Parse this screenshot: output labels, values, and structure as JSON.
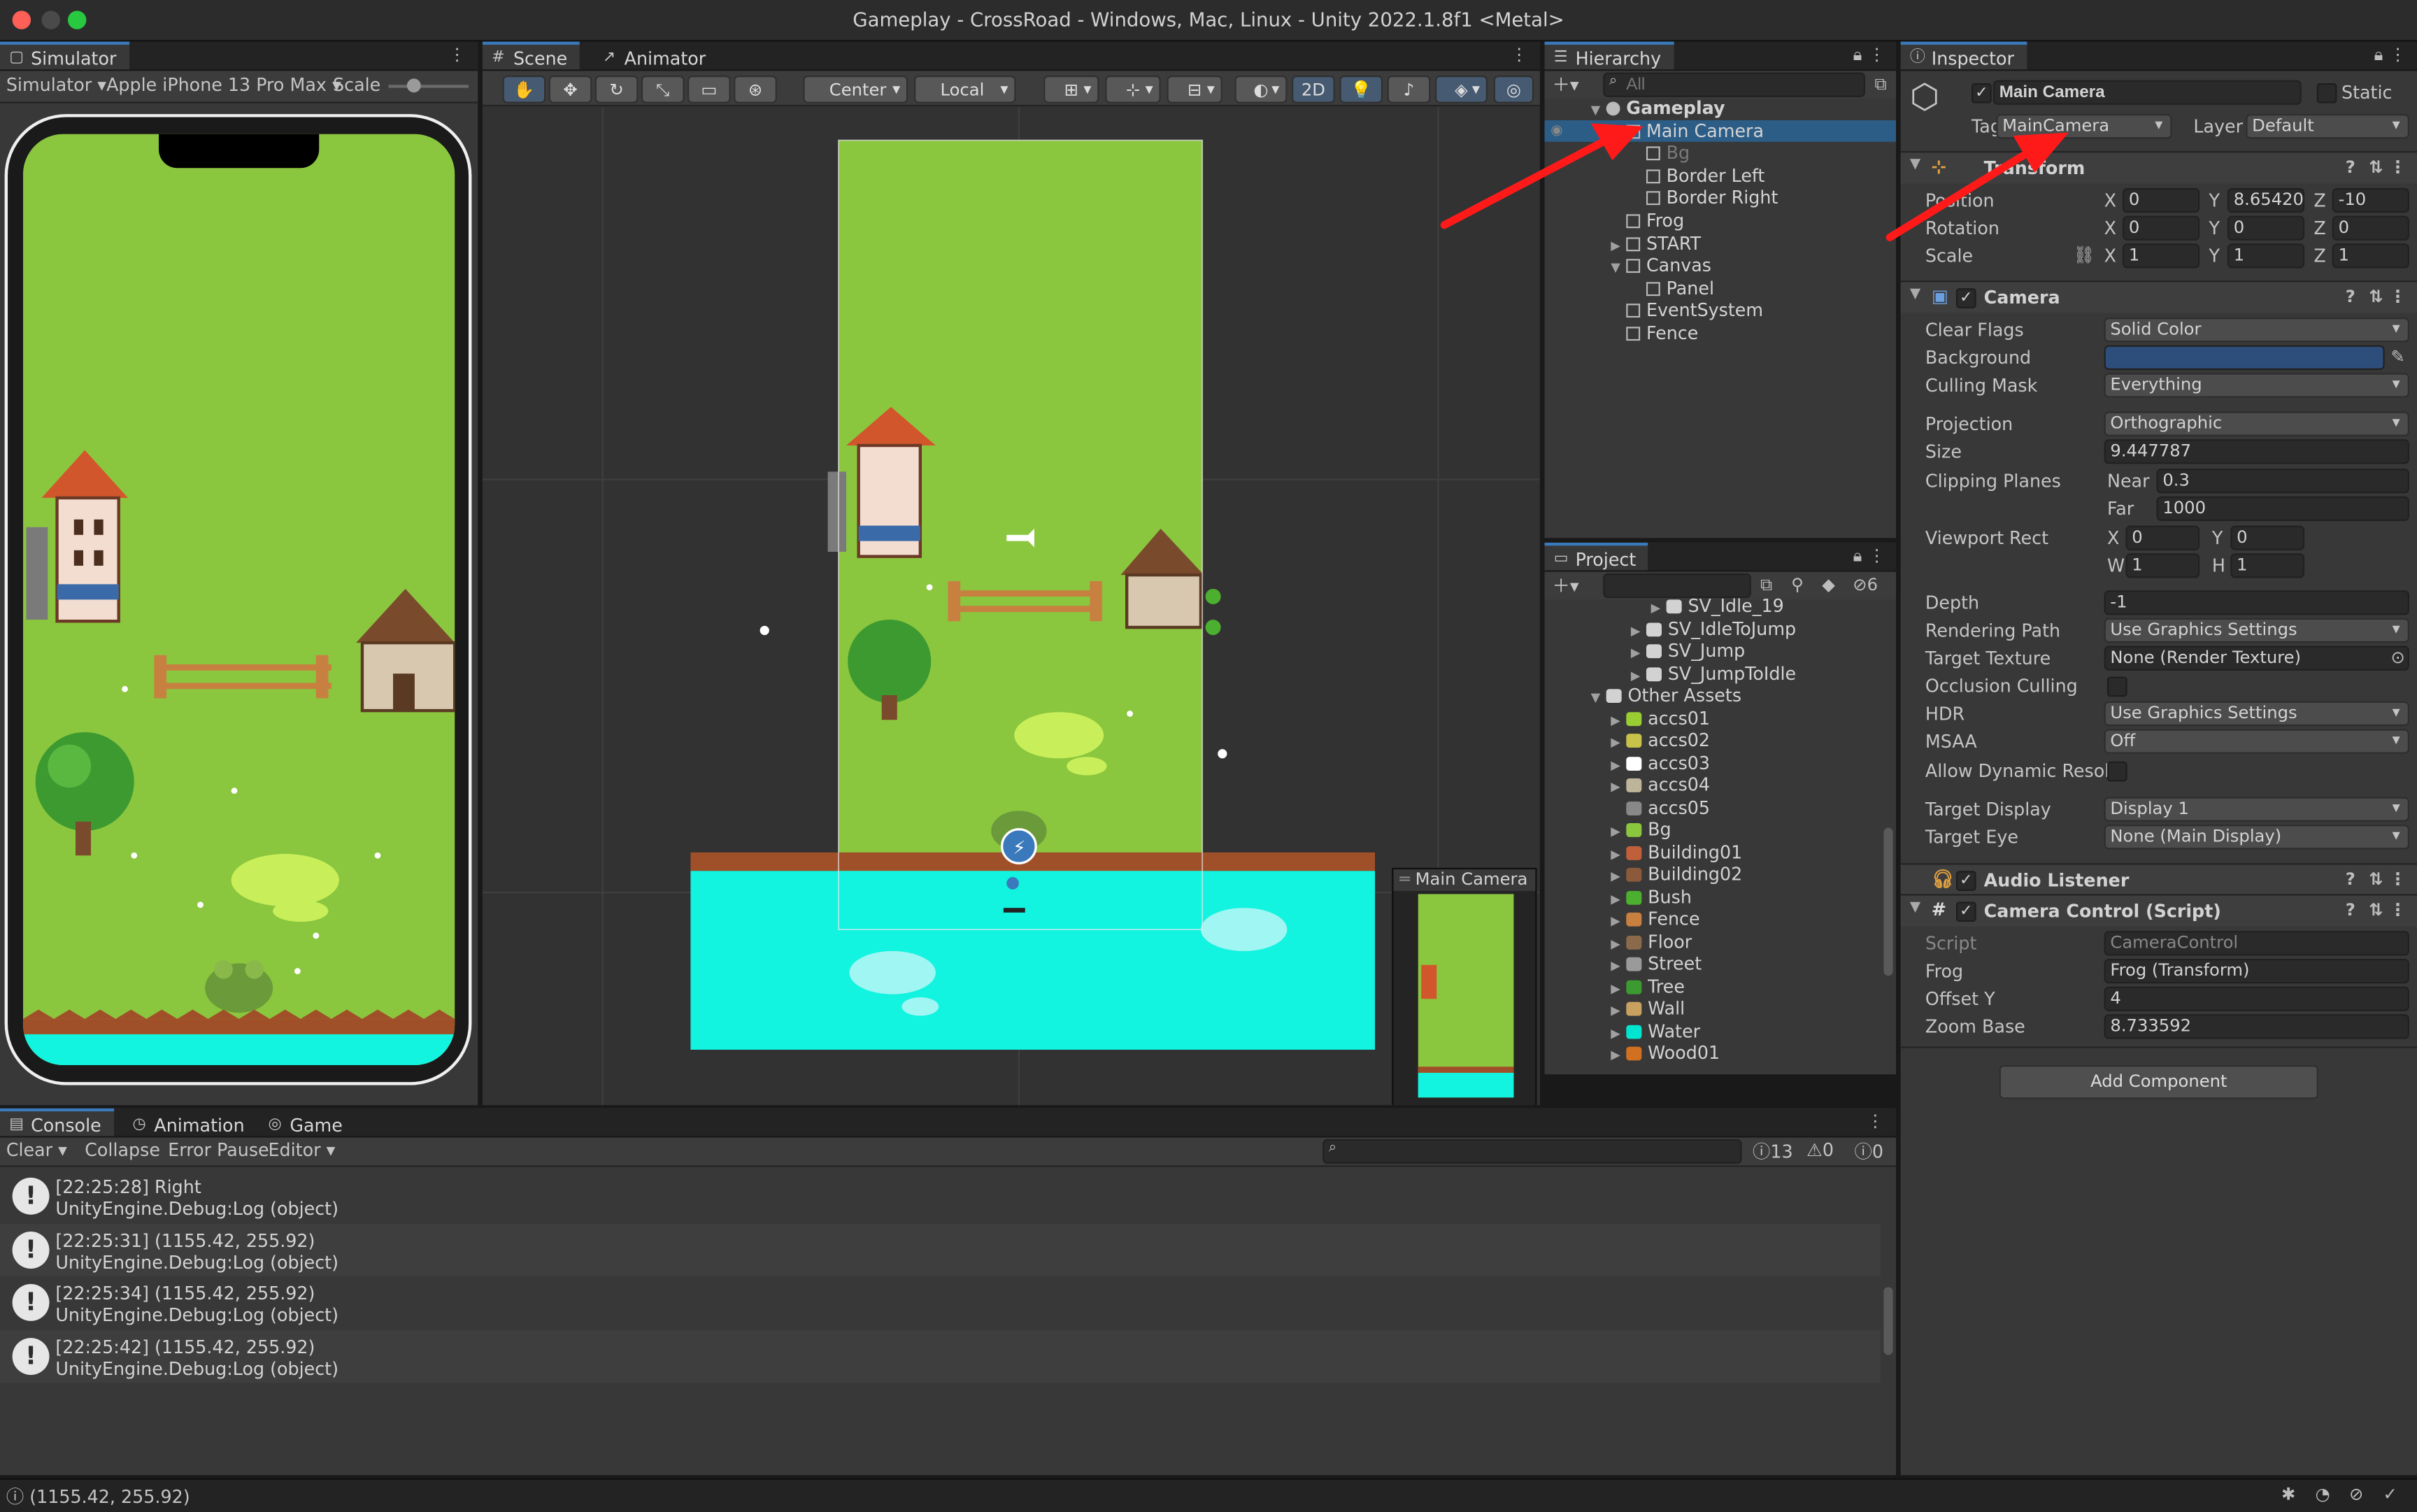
{
  "window": {
    "title": "Gameplay - CrossRoad - Windows, Mac, Linux - Unity 2022.1.8f1 <Metal>"
  },
  "simulator": {
    "tab": "Simulator",
    "mode": "Simulator",
    "device": "Apple iPhone 13 Pro Max",
    "scale_label": "Scale"
  },
  "scene": {
    "tab_scene": "Scene",
    "tab_animator": "Animator",
    "pivot": "Center",
    "space": "Local",
    "mode_2d": "2D",
    "camera_preview_title": "Main Camera"
  },
  "hierarchy": {
    "tab": "Hierarchy",
    "search_placeholder": "All",
    "items": [
      {
        "label": "Gameplay",
        "depth": 0,
        "fold": "open",
        "icon": "unity-scene-icon"
      },
      {
        "label": "Main Camera",
        "depth": 1,
        "fold": "none",
        "icon": "cube-icon",
        "selected": true
      },
      {
        "label": "Bg",
        "depth": 2,
        "fold": "none",
        "icon": "cube-icon",
        "dim": true
      },
      {
        "label": "Border Left",
        "depth": 2,
        "fold": "none",
        "icon": "cube-icon"
      },
      {
        "label": "Border Right",
        "depth": 2,
        "fold": "none",
        "icon": "cube-icon"
      },
      {
        "label": "Frog",
        "depth": 1,
        "fold": "none",
        "icon": "cube-icon"
      },
      {
        "label": "START",
        "depth": 1,
        "fold": "closed",
        "icon": "cube-icon"
      },
      {
        "label": "Canvas",
        "depth": 1,
        "fold": "open",
        "icon": "cube-icon"
      },
      {
        "label": "Panel",
        "depth": 2,
        "fold": "none",
        "icon": "cube-icon"
      },
      {
        "label": "EventSystem",
        "depth": 1,
        "fold": "none",
        "icon": "cube-icon"
      },
      {
        "label": "Fence",
        "depth": 1,
        "fold": "none",
        "icon": "cube-icon"
      }
    ]
  },
  "project": {
    "tab": "Project",
    "hidden_count": "6",
    "items": [
      {
        "label": "SV_Idle_19",
        "depth": 3,
        "fold": "closed",
        "color": "#d2d2d2"
      },
      {
        "label": "SV_IdleToJump",
        "depth": 2,
        "fold": "closed",
        "color": "#d2d2d2"
      },
      {
        "label": "SV_Jump",
        "depth": 2,
        "fold": "closed",
        "color": "#d2d2d2"
      },
      {
        "label": "SV_JumpToIdle",
        "depth": 2,
        "fold": "closed",
        "color": "#d2d2d2"
      },
      {
        "label": "Other Assets",
        "depth": 0,
        "fold": "open",
        "color": "#d2d2d2"
      },
      {
        "label": "accs01",
        "depth": 1,
        "fold": "closed",
        "color": "#9acd32"
      },
      {
        "label": "accs02",
        "depth": 1,
        "fold": "closed",
        "color": "#c8c24a"
      },
      {
        "label": "accs03",
        "depth": 1,
        "fold": "closed",
        "color": "#ffffff"
      },
      {
        "label": "accs04",
        "depth": 1,
        "fold": "closed",
        "color": "#bdb49a"
      },
      {
        "label": "accs05",
        "depth": 1,
        "fold": "none",
        "color": "#888888"
      },
      {
        "label": "Bg",
        "depth": 1,
        "fold": "closed",
        "color": "#8bc63f"
      },
      {
        "label": "Building01",
        "depth": 1,
        "fold": "closed",
        "color": "#c0603a"
      },
      {
        "label": "Building02",
        "depth": 1,
        "fold": "closed",
        "color": "#8a5a3a"
      },
      {
        "label": "Bush",
        "depth": 1,
        "fold": "closed",
        "color": "#4caf30"
      },
      {
        "label": "Fence",
        "depth": 1,
        "fold": "closed",
        "color": "#c88040"
      },
      {
        "label": "Floor",
        "depth": 1,
        "fold": "closed",
        "color": "#8a6a4a"
      },
      {
        "label": "Street",
        "depth": 1,
        "fold": "closed",
        "color": "#9a9a9a"
      },
      {
        "label": "Tree",
        "depth": 1,
        "fold": "closed",
        "color": "#3c9a30"
      },
      {
        "label": "Wall",
        "depth": 1,
        "fold": "closed",
        "color": "#c8a060"
      },
      {
        "label": "Water",
        "depth": 1,
        "fold": "closed",
        "color": "#00e5d0"
      },
      {
        "label": "Wood01",
        "depth": 1,
        "fold": "closed",
        "color": "#d07020"
      }
    ]
  },
  "inspector": {
    "tab": "Inspector",
    "object_name": "Main Camera",
    "static_label": "Static",
    "tag_label": "Tag",
    "tag_value": "MainCamera",
    "layer_label": "Layer",
    "layer_value": "Default",
    "transform": {
      "title": "Transform",
      "position": {
        "label": "Position",
        "x": "0",
        "y": "8.654205",
        "z": "-10"
      },
      "rotation": {
        "label": "Rotation",
        "x": "0",
        "y": "0",
        "z": "0"
      },
      "scale": {
        "label": "Scale",
        "x": "1",
        "y": "1",
        "z": "1"
      }
    },
    "camera": {
      "title": "Camera",
      "fields": [
        {
          "label": "Clear Flags",
          "value": "Solid Color",
          "kind": "dropdown"
        },
        {
          "label": "Background",
          "value": "",
          "kind": "color"
        },
        {
          "label": "Culling Mask",
          "value": "Everything",
          "kind": "dropdown"
        },
        {
          "label": "Projection",
          "value": "Orthographic",
          "kind": "dropdown"
        },
        {
          "label": "Size",
          "value": "9.447787",
          "kind": "text"
        },
        {
          "label": "Clipping Planes",
          "value": "",
          "kind": "none"
        }
      ],
      "near_label": "Near",
      "near": "0.3",
      "far_label": "Far",
      "far": "1000",
      "viewport_label": "Viewport Rect",
      "vx": "0",
      "vy": "0",
      "vw": "1",
      "vh": "1",
      "fields2": [
        {
          "label": "Depth",
          "value": "-1",
          "kind": "text"
        },
        {
          "label": "Rendering Path",
          "value": "Use Graphics Settings",
          "kind": "dropdown"
        },
        {
          "label": "Target Texture",
          "value": "None (Render Texture)",
          "kind": "object"
        },
        {
          "label": "Occlusion Culling",
          "value": "",
          "kind": "check"
        },
        {
          "label": "HDR",
          "value": "Use Graphics Settings",
          "kind": "dropdown"
        },
        {
          "label": "MSAA",
          "value": "Off",
          "kind": "dropdown"
        },
        {
          "label": "Allow Dynamic Resolu",
          "value": "",
          "kind": "check"
        },
        {
          "label": "Target Display",
          "value": "Display 1",
          "kind": "dropdown"
        },
        {
          "label": "Target Eye",
          "value": "None (Main Display)",
          "kind": "dropdown"
        }
      ],
      "background_color": "#2d4d7a"
    },
    "audio": {
      "title": "Audio Listener"
    },
    "script": {
      "title": "Camera Control (Script)",
      "script_label": "Script",
      "script_value": "CameraControl",
      "frog_label": "Frog",
      "frog_value": "Frog (Transform)",
      "offset_label": "Offset Y",
      "offset_value": "4",
      "zoom_label": "Zoom Base",
      "zoom_value": "8.733592"
    },
    "add_component": "Add Component"
  },
  "console": {
    "tabs": [
      "Console",
      "Animation",
      "Game"
    ],
    "clear": "Clear",
    "collapse": "Collapse",
    "error_pause": "Error Pause",
    "editor": "Editor",
    "count_log": "13",
    "count_warn": "0",
    "count_err": "0",
    "logs": [
      {
        "line1": "[22:25:28] Right",
        "line2": "UnityEngine.Debug:Log (object)"
      },
      {
        "line1": "[22:25:31] (1155.42, 255.92)",
        "line2": "UnityEngine.Debug:Log (object)"
      },
      {
        "line1": "[22:25:34] (1155.42, 255.92)",
        "line2": "UnityEngine.Debug:Log (object)"
      },
      {
        "line1": "[22:25:42] (1155.42, 255.92)",
        "line2": "UnityEngine.Debug:Log (object)"
      }
    ]
  },
  "statusbar": {
    "text": "(1155.42, 255.92)"
  },
  "colors": {
    "grass": "#8bc63f",
    "water": "#12f3e0",
    "accent": "#3a79bb",
    "selected": "#2c5d87",
    "annotation_arrow": "#ff1a1a"
  }
}
